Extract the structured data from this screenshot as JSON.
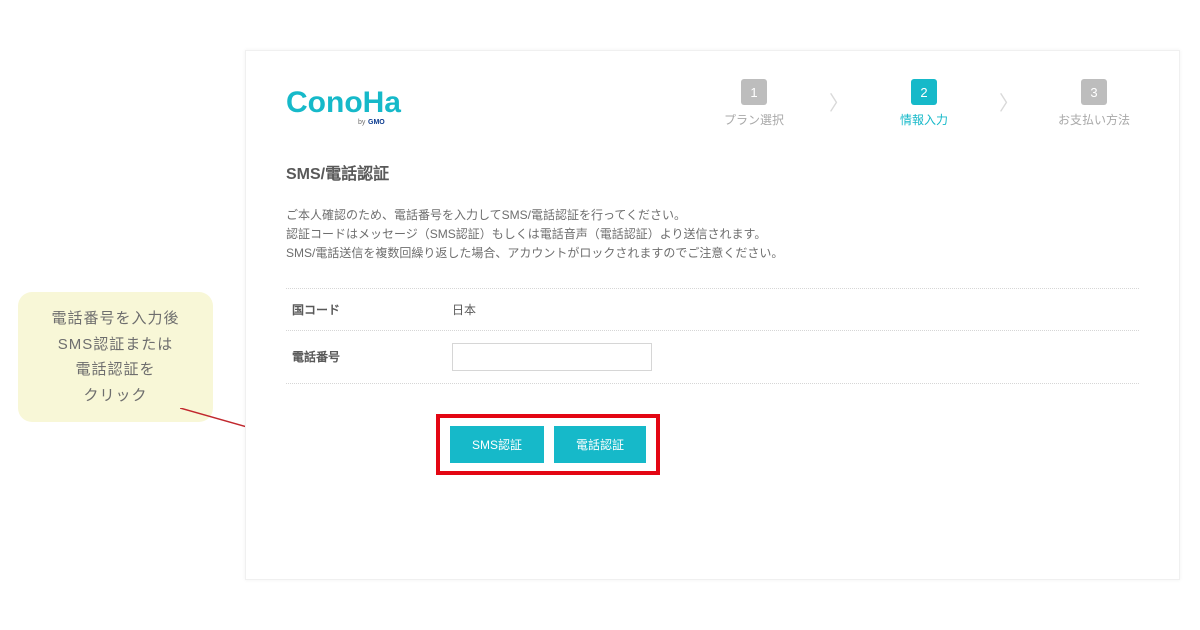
{
  "logo": {
    "brand": "ConoHa",
    "tagline": "by GMO"
  },
  "stepper": {
    "steps": [
      {
        "num": "1",
        "label": "プラン選択",
        "active": false
      },
      {
        "num": "2",
        "label": "情報入力",
        "active": true
      },
      {
        "num": "3",
        "label": "お支払い方法",
        "active": false
      }
    ]
  },
  "section": {
    "title": "SMS/電話認証",
    "desc_line1": "ご本人確認のため、電話番号を入力してSMS/電話認証を行ってください。",
    "desc_line2": "認証コードはメッセージ（SMS認証）もしくは電話音声（電話認証）より送信されます。",
    "desc_line3": "SMS/電話送信を複数回繰り返した場合、アカウントがロックされますのでご注意ください。"
  },
  "form": {
    "country_code_label": "国コード",
    "country_code_value": "日本",
    "phone_label": "電話番号",
    "phone_value": ""
  },
  "buttons": {
    "sms": "SMS認証",
    "phone": "電話認証"
  },
  "callout": {
    "line1": "電話番号を入力後",
    "line2": "SMS認証または",
    "line3": "電話認証を",
    "line4": "クリック"
  }
}
